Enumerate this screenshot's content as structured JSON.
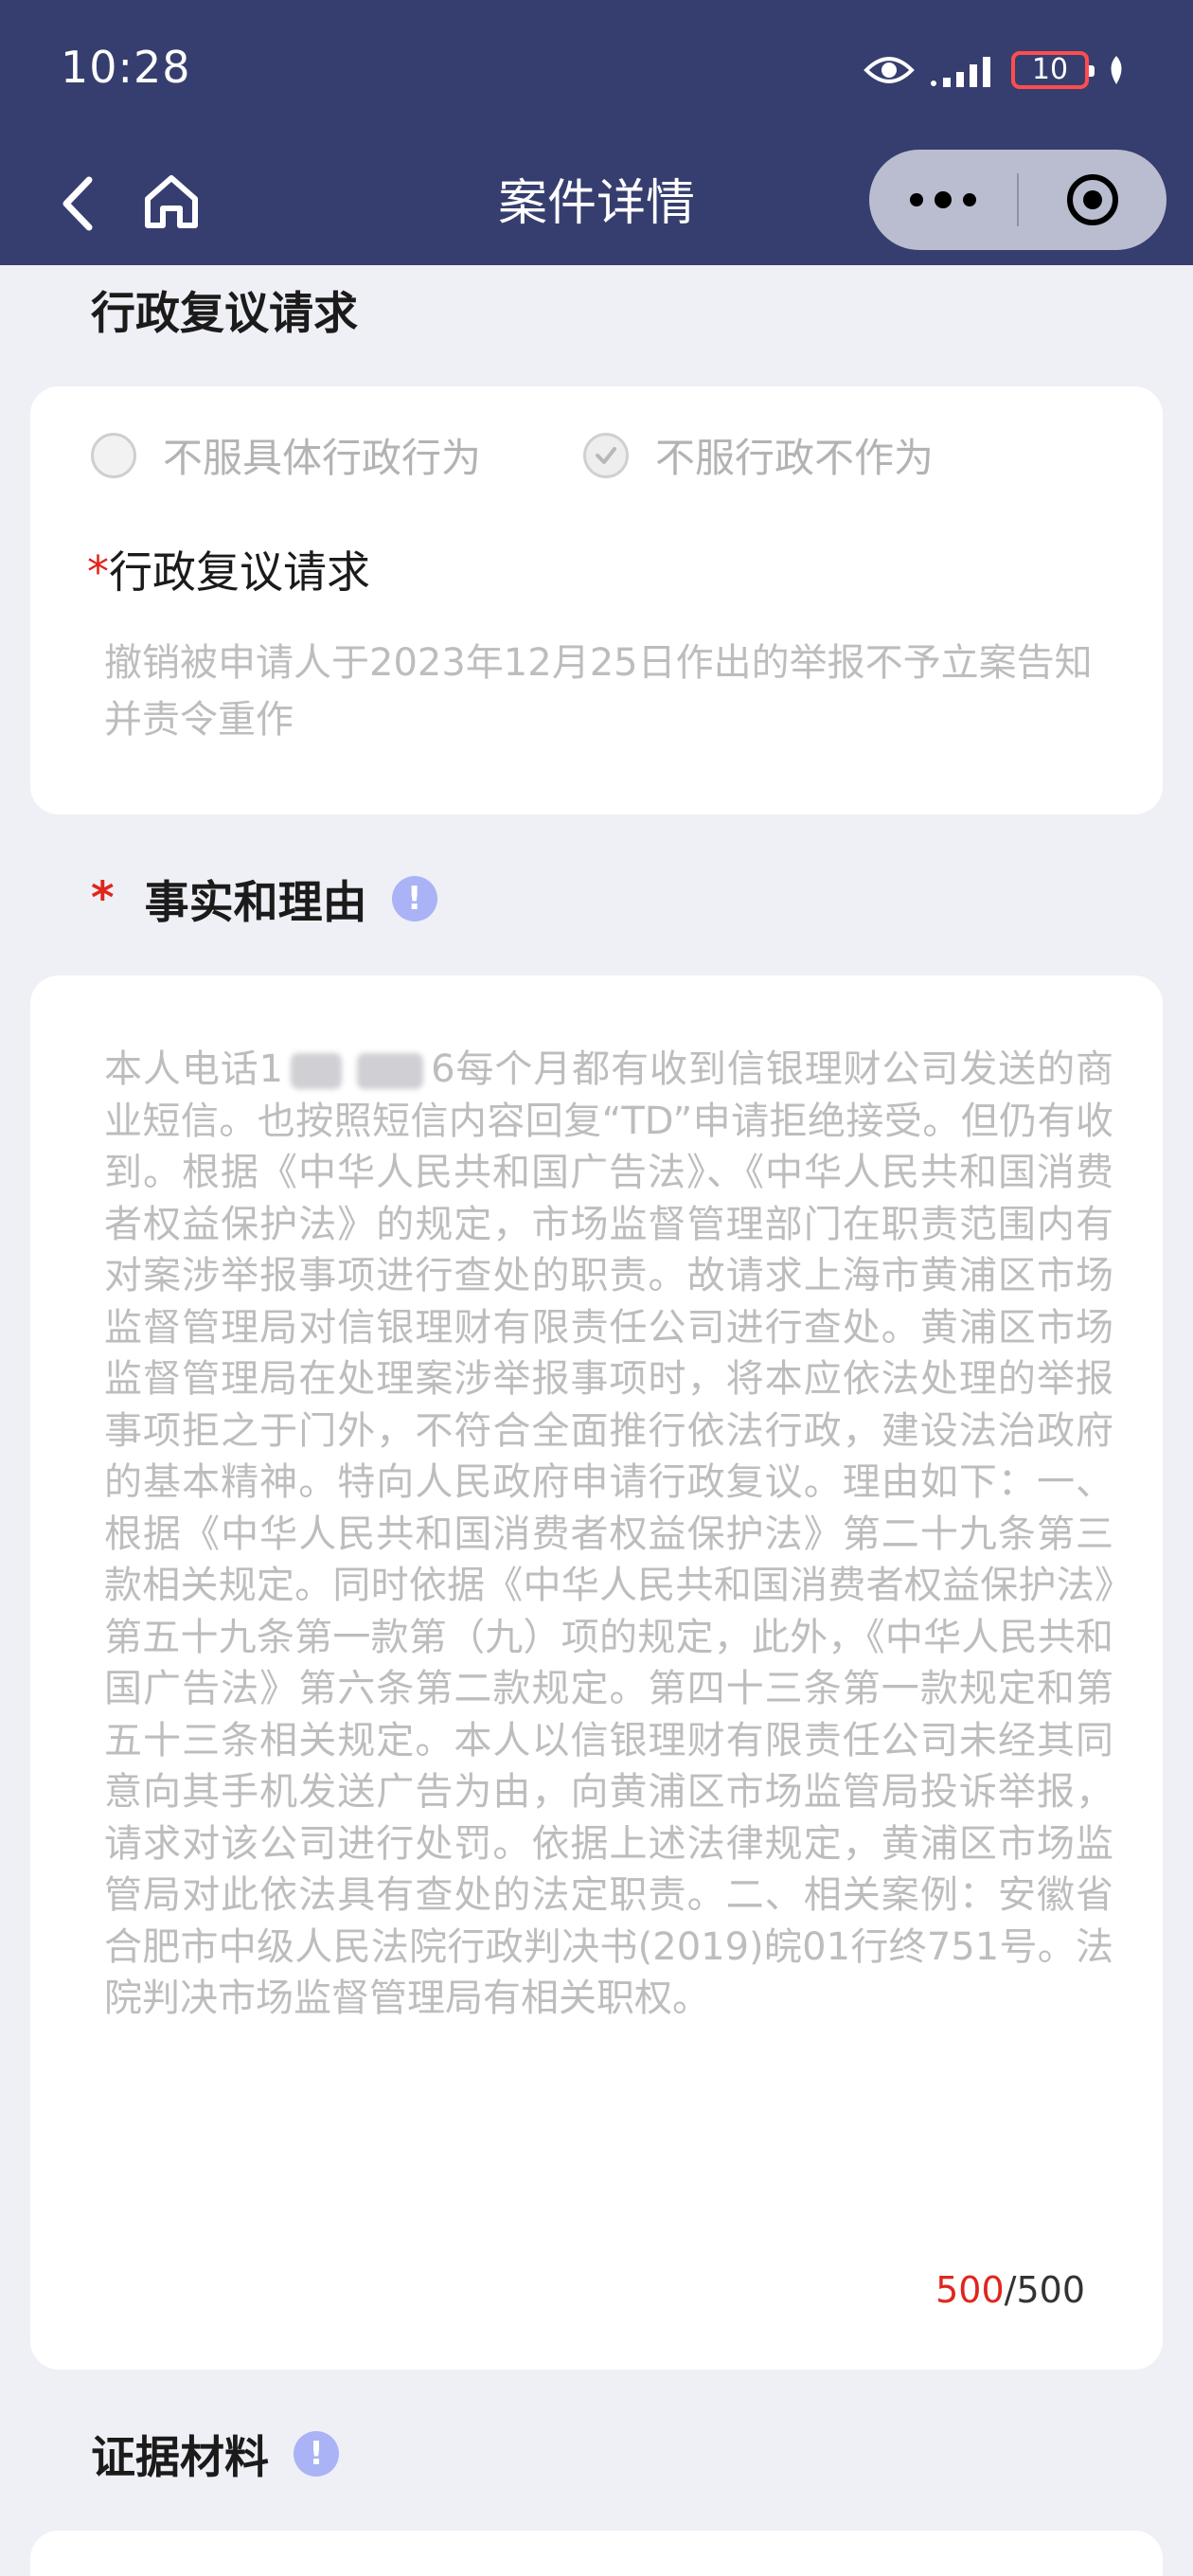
{
  "status_bar": {
    "time": "10:28",
    "battery": "10",
    "icons": [
      "eye-icon",
      "signal-icon",
      "battery-icon",
      "leaf-icon"
    ]
  },
  "nav": {
    "title": "案件详情",
    "back_icon": "chevron-left-icon",
    "home_icon": "home-icon",
    "more_icon": "more-dots-icon",
    "close_icon": "target-icon"
  },
  "review_request_section": {
    "title": "行政复议请求",
    "options": [
      {
        "label": "不服具体行政行为",
        "checked": false
      },
      {
        "label": "不服行政不作为",
        "checked": true
      }
    ],
    "required_mark": "*",
    "field_label": "行政复议请求",
    "field_value": "撤销被申请人于2023年12月25日作出的举报不予立案告知并责令重作"
  },
  "facts_section": {
    "required_mark": "*",
    "title": "事实和理由",
    "info_glyph": "!",
    "text_prefix": "本人电话1",
    "text_body": "6每个月都有收到信银理财公司发送的商业短信。也按照短信内容回复“TD”申请拒绝接受。但仍有收到。根据《中华人民共和国广告法》、《中华人民共和国消费者权益保护法》的规定，市场监督管理部门在职责范围内有对案涉举报事项进行查处的职责。故请求上海市黄浦区市场监督管理局对信银理财有限责任公司进行查处。黄浦区市场监督管理局在处理案涉举报事项时，将本应依法处理的举报事项拒之于门外，不符合全面推行依法行政，建设法治政府的基本精神。特向人民政府申请行政复议。理由如下：一、根据《中华人民共和国消费者权益保护法》第二十九条第三款相关规定。同时依据《中华人民共和国消费者权益保护法》第五十九条第一款第（九）项的规定，此外，《中华人民共和国广告法》第六条第二款规定。第四十三条第一款规定和第五十三条相关规定。本人以信银理财有限责任公司未经其同意向其手机发送广告为由，向黄浦区市场监管局投诉举报，请求对该公司进行处罚。依据上述法律规定，黄浦区市场监管局对此依法具有查处的法定职责。二、相关案例：安徽省合肥市中级人民法院行政判决书(2019)皖01行终751号。法院判决市场监督管理局有相关职权。",
    "count_used": "500",
    "count_max": "/500"
  },
  "evidence_section": {
    "title": "证据材料",
    "info_glyph": "!"
  },
  "colors": {
    "header_bg": "#363e6f",
    "page_bg": "#eff0f5",
    "required_red": "#e0261d",
    "info_blue": "#a9b3f5"
  }
}
